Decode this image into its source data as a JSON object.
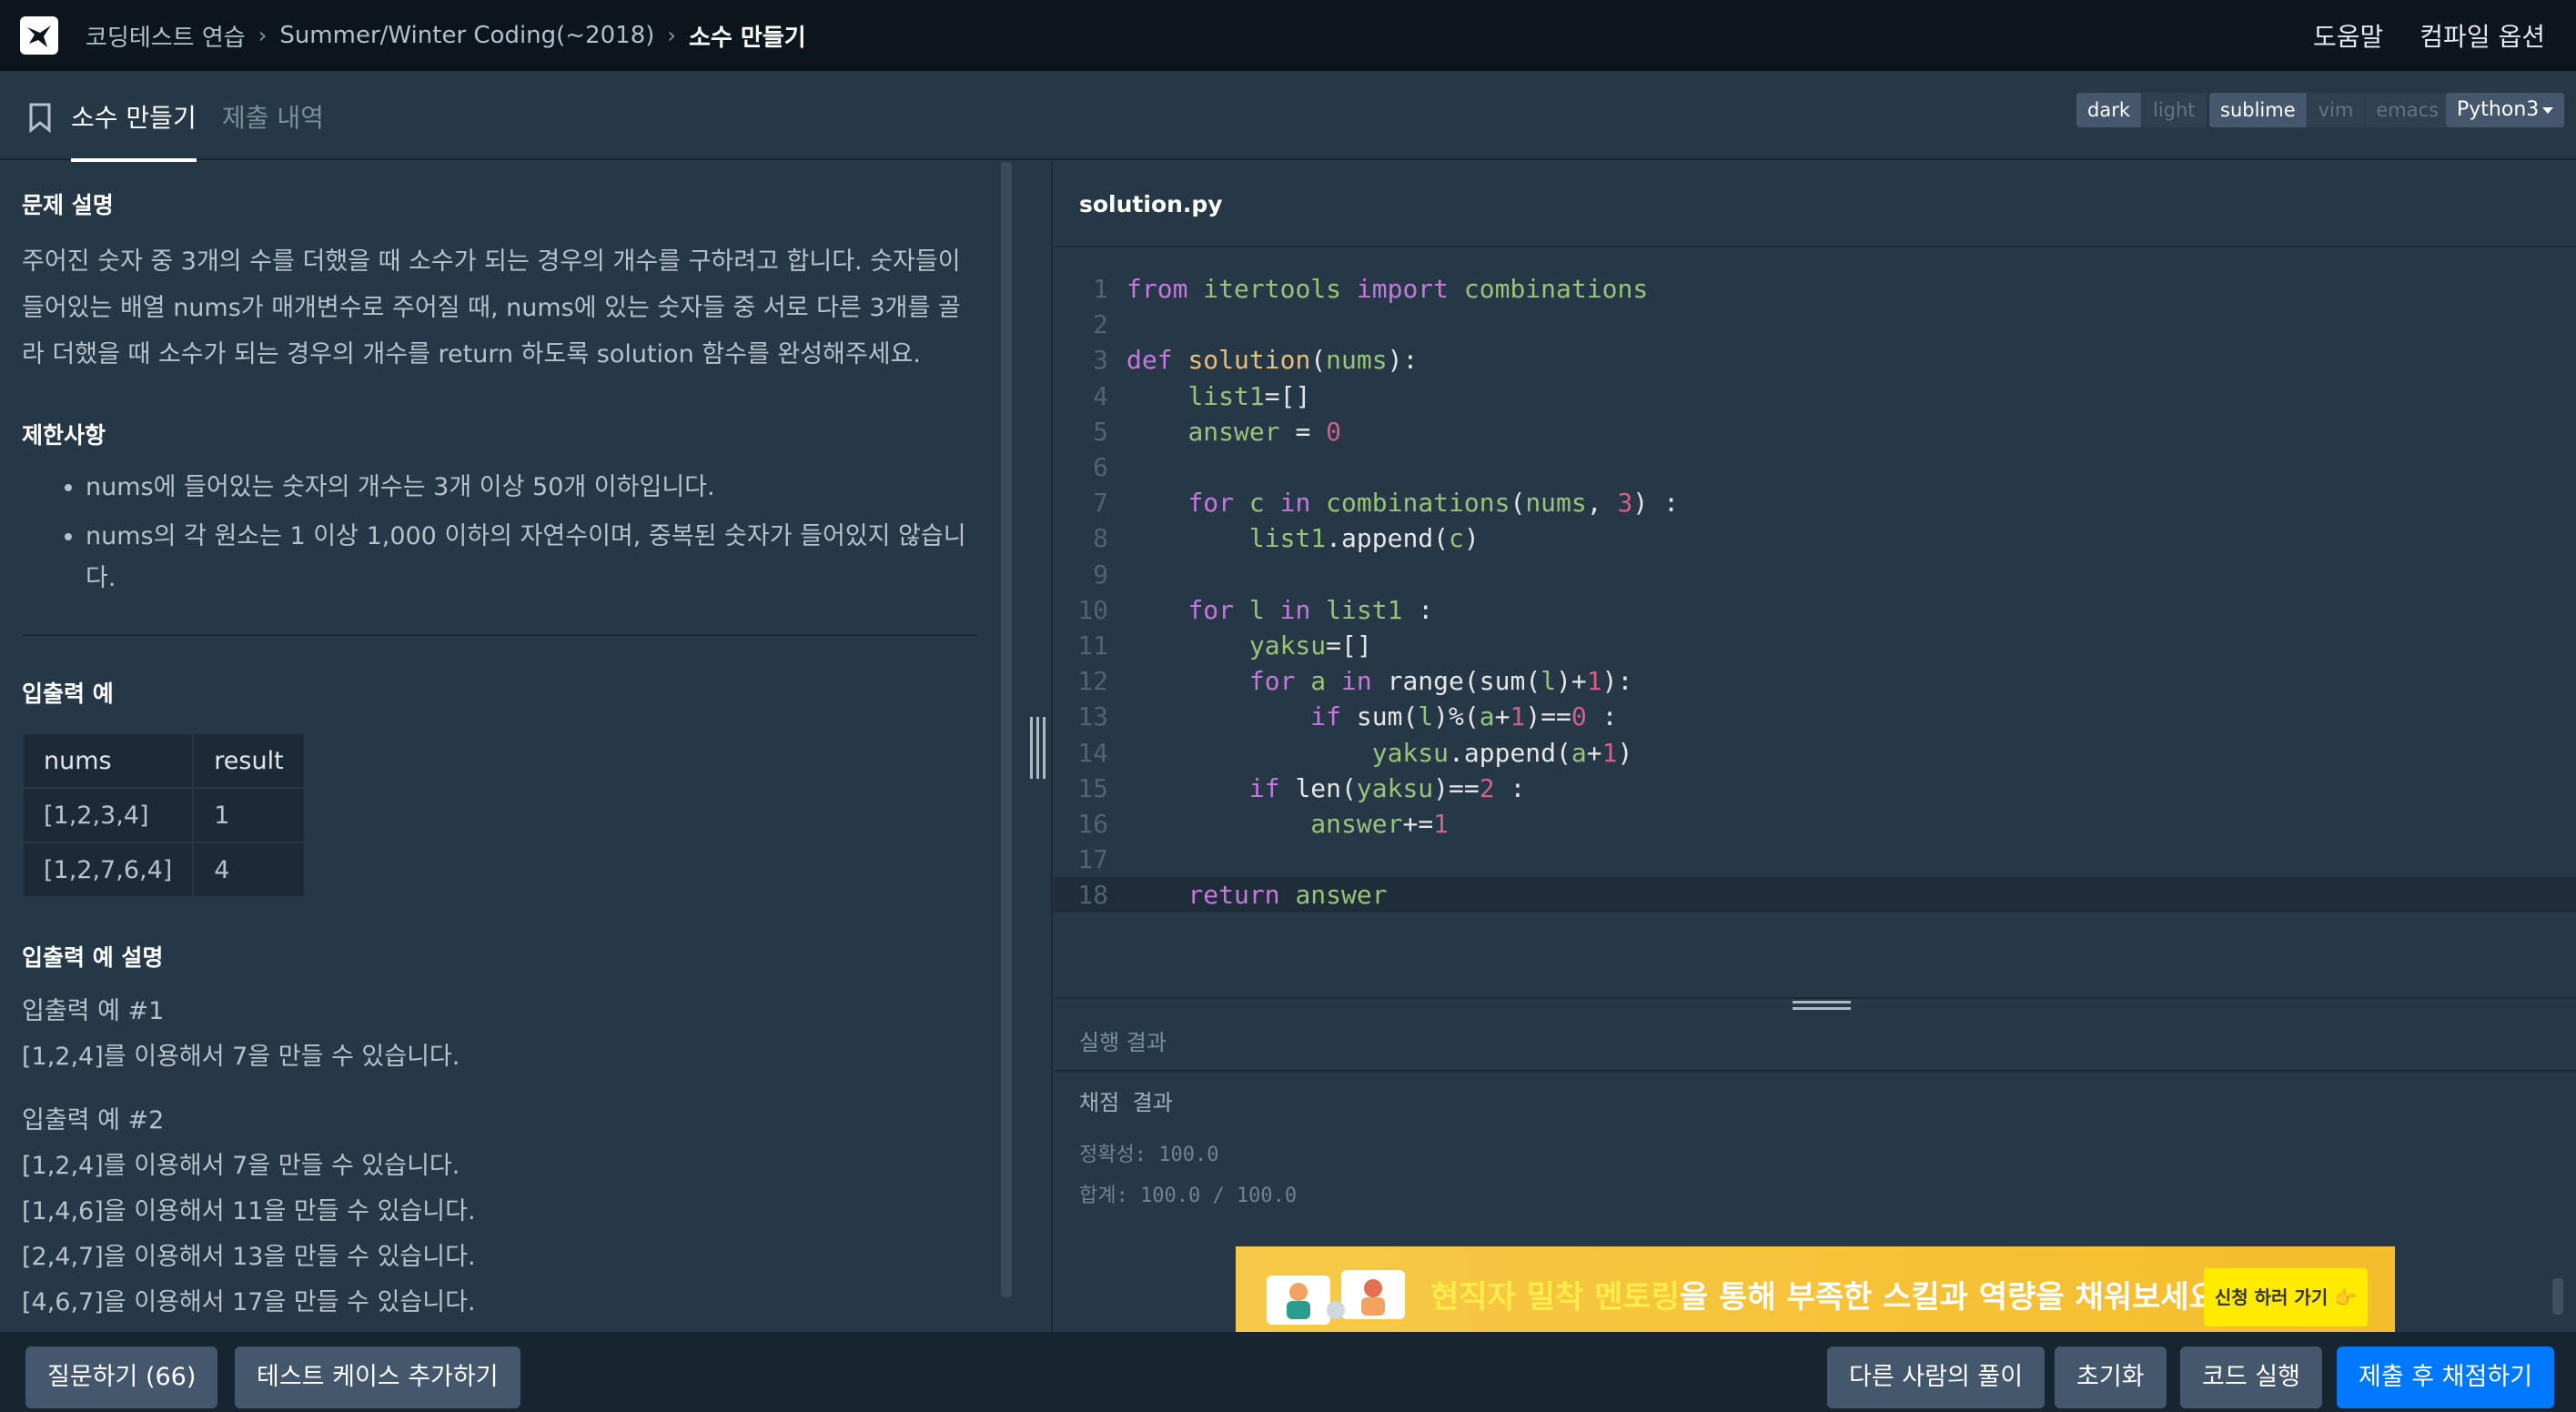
{
  "nav": {
    "breadcrumbs": [
      "코딩테스트 연습",
      "Summer/Winter Coding(~2018)",
      "소수 만들기"
    ],
    "help": "도움말",
    "compile_options": "컴파일 옵션"
  },
  "tabs": {
    "problem": "소수 만들기",
    "submissions": "제출 내역"
  },
  "toggles": {
    "theme": [
      "dark",
      "light"
    ],
    "keymap": [
      "sublime",
      "vim",
      "emacs"
    ],
    "language": "Python3"
  },
  "problem": {
    "desc_title": "문제 설명",
    "desc_lines": [
      "주어진 숫자 중 3개의 수를 더했을 때 소수가 되는 경우의 개수를 구하려고 합니다. 숫자들이",
      "들어있는 배열 nums가 매개변수로 주어질 때, nums에 있는 숫자들 중 서로 다른 3개를 골",
      "라 더했을 때 소수가 되는 경우의 개수를 return 하도록 solution 함수를 완성해주세요."
    ],
    "limits_title": "제한사항",
    "limits": [
      "nums에 들어있는 숫자의 개수는 3개 이상 50개 이하입니다.",
      "nums의 각 원소는 1 이상 1,000 이하의 자연수이며, 중복된 숫자가 들어있지 않습니\n다."
    ],
    "io_title": "입출력 예",
    "io_headers": [
      "nums",
      "result"
    ],
    "io_rows": [
      [
        "[1,2,3,4]",
        "1"
      ],
      [
        "[1,2,7,6,4]",
        "4"
      ]
    ],
    "expl_title": "입출력 예 설명",
    "expl1_title": "입출력 예 #1",
    "expl1_lines": [
      "[1,2,4]를 이용해서 7을 만들 수 있습니다."
    ],
    "expl2_title": "입출력 예 #2",
    "expl2_lines": [
      "[1,2,4]를 이용해서 7을 만들 수 있습니다.",
      "[1,4,6]을 이용해서 11을 만들 수 있습니다.",
      "[2,4,7]을 이용해서 13을 만들 수 있습니다.",
      "[4,6,7]을 이용해서 17을 만들 수 있습니다."
    ]
  },
  "editor": {
    "filename": "solution.py",
    "lines": [
      "from itertools import combinations",
      "",
      "def solution(nums):",
      "    list1=[]",
      "    answer = 0",
      "",
      "    for c in combinations(nums, 3) :",
      "        list1.append(c)",
      "",
      "    for l in list1 :",
      "        yaksu=[]",
      "        for a in range(sum(l)+1):",
      "            if sum(l)%(a+1)==0 :",
      "                yaksu.append(a+1)",
      "        if len(yaksu)==2 :",
      "            answer+=1",
      "",
      "    return answer"
    ]
  },
  "result": {
    "title": "실행 결과",
    "grading_title": "채점 결과",
    "accuracy": "정확성: 100.0",
    "total": "합계: 100.0 / 100.0"
  },
  "banner": {
    "text_highlight": "현직자 밀착 멘토링",
    "text_rest": "을 통해 부족한 스킬과 역량을 채워보세요",
    "button": "신청 하러 가기 👉"
  },
  "bottom": {
    "question": "질문하기 (66)",
    "add_testcase": "테스트 케이스 추가하기",
    "others_solutions": "다른 사람의 풀이",
    "reset": "초기화",
    "run": "코드 실행",
    "submit": "제출 후 채점하기"
  },
  "colors": {
    "primary": "#0078ff",
    "bg": "#263747",
    "nav": "#0c151c"
  }
}
